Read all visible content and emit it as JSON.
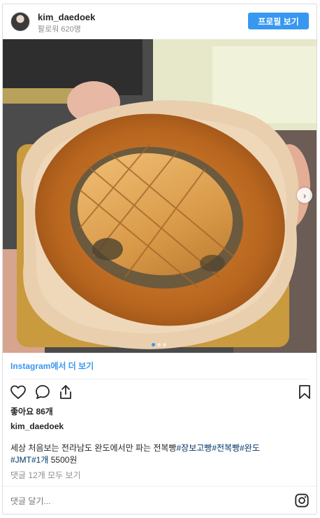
{
  "header": {
    "username": "kim_daedoek",
    "followers": "팔로워 620명",
    "profile_button": "프로필 보기"
  },
  "photo": {
    "carousel_dots": 3,
    "active_dot": 0
  },
  "view_more": "Instagram에서 더 보기",
  "actions": {
    "icons": [
      "heart-icon",
      "comment-icon",
      "share-icon",
      "bookmark-icon"
    ]
  },
  "likes": "좋아요 86개",
  "author": "kim_daedoek",
  "caption": {
    "line1_text": "세상 처음보는 전라남도 완도에서만 파는 전복빵",
    "line1_tags": "#장보고빵#전복빵#완도",
    "line2_tags": "#JMT#1개",
    "line2_text": " 5500원"
  },
  "comments_link": "댓글 12개 모두 보기",
  "comment_placeholder": "댓글 달기...",
  "colors": {
    "accent": "#3897f0",
    "hashtag": "#003569",
    "muted": "#8e8e8e",
    "text": "#262626"
  }
}
